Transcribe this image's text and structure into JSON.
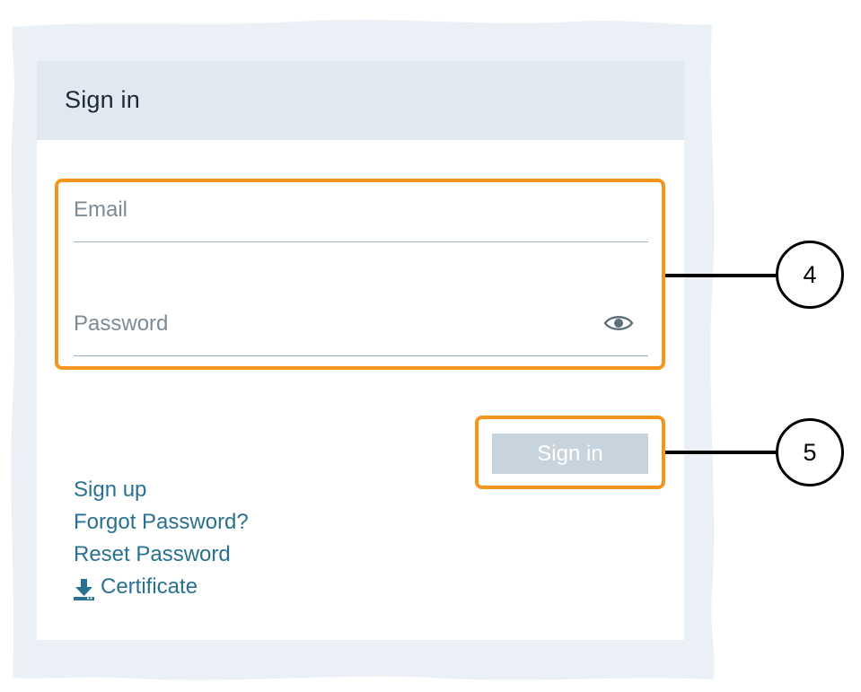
{
  "card": {
    "title": "Sign in"
  },
  "form": {
    "email_placeholder": "Email",
    "password_placeholder": "Password",
    "signin_button": "Sign in"
  },
  "links": {
    "signup": "Sign up",
    "forgot_password": "Forgot Password?",
    "reset_password": "Reset Password",
    "certificate": "Certificate"
  },
  "callouts": {
    "fields_number": "4",
    "button_number": "5"
  },
  "colors": {
    "header_bg": "#e2e8ef",
    "link": "#2a7191",
    "button_disabled": "#c8d4dd",
    "callout_frame": "#f7941d",
    "torn_background": "#eaf0f5"
  }
}
